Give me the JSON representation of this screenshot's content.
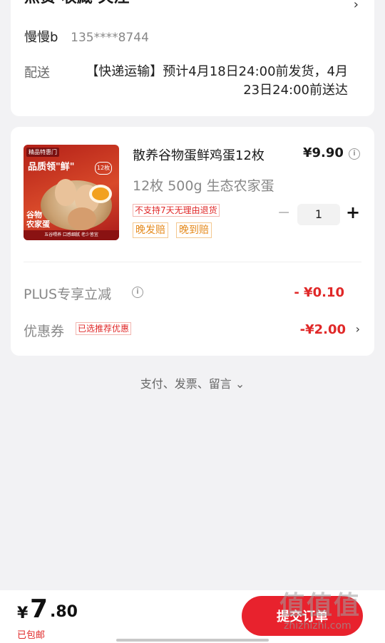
{
  "address": {
    "name": "点赞 收藏 关注",
    "contact_name": "慢慢b",
    "contact_phone": "135****8744",
    "arrow": "›"
  },
  "shipping": {
    "label": "配送",
    "text": "【快递运输】预计4月18日24:00前发货，4月23日24:00前送达"
  },
  "product": {
    "title": "散养谷物蛋鲜鸡蛋12枚",
    "price": "¥9.90",
    "spec": "12枚 500g 生态农家蛋",
    "no_return": "不支持7天无理由退货",
    "badges": [
      "晚发赔",
      "晚到赔"
    ],
    "quantity": "1",
    "minus": "−",
    "plus": "+",
    "thumb": {
      "store_tag": "精品特惠门",
      "slogan": "品质领\"鲜\"",
      "badge": "12枚",
      "big_text": "谷物\n农家蛋",
      "strip": "五谷喂养 口感细腻 老少皆宜"
    }
  },
  "discounts": {
    "plus_label": "PLUS专享立减",
    "plus_value": "- ¥0.10",
    "coupon_label": "优惠券",
    "coupon_tag": "已选推荐优惠",
    "coupon_value": "-¥2.00"
  },
  "footer_links": "支付、发票、留言 ⌄",
  "bottom": {
    "currency": "¥",
    "price_int": "7",
    "price_dec": ".80",
    "shipping_note": "已包邮",
    "submit_label": "提交订单"
  },
  "watermark": {
    "logo": "值值值",
    "url": "zhizhizhi.com"
  },
  "colors": {
    "accent": "#e8222d",
    "price_red": "#e02828",
    "background": "#f2f2f4"
  }
}
